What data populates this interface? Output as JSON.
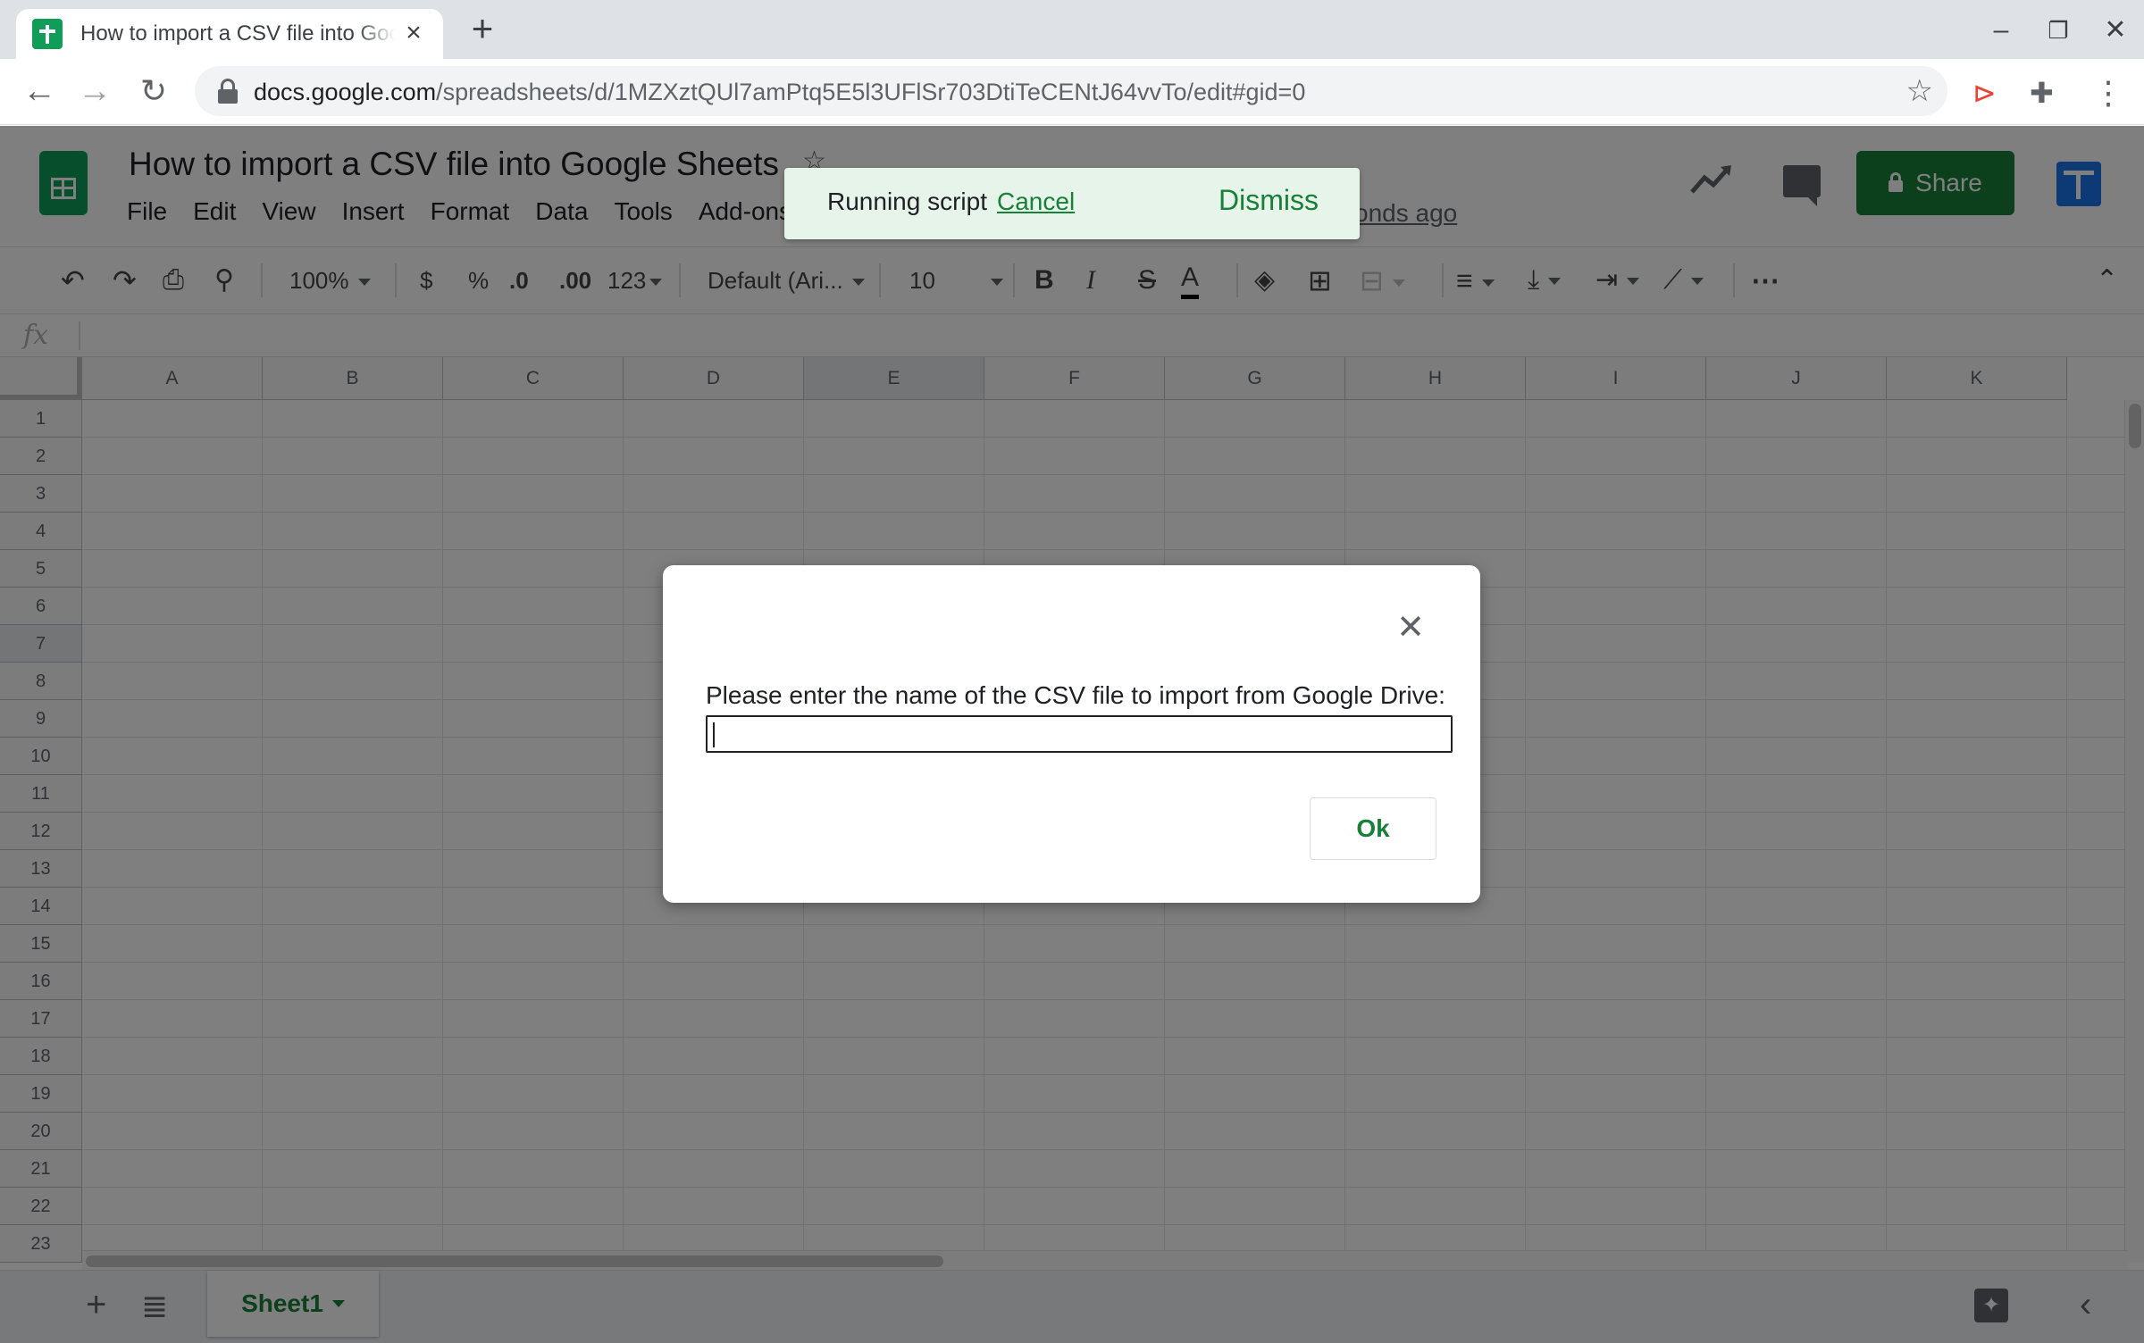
{
  "browser": {
    "tab_title": "How to import a CSV file into Google Sheets",
    "url_host": "docs.google.com",
    "url_path": "/spreadsheets/d/1MZXztQUl7amPtq5E5l3UFlSr703DtiTeCENtJ64vvTo/edit#gid=0"
  },
  "sheets": {
    "doc_title": "How to import a CSV file into Google Sheets",
    "menu": [
      "File",
      "Edit",
      "View",
      "Insert",
      "Format",
      "Data",
      "Tools",
      "Add-ons"
    ],
    "last_edit": "onds ago",
    "share_label": "Share",
    "toolbar": {
      "zoom": "100%",
      "currency": "$",
      "percent": "%",
      "dec_less": ".0",
      "dec_more": ".00",
      "more_formats": "123",
      "font": "Default (Ari...",
      "font_size": "10",
      "bold": "B",
      "italic": "I",
      "strike": "S",
      "text_color": "A",
      "more": "⋯"
    },
    "fx": "fx",
    "columns": [
      "A",
      "B",
      "C",
      "D",
      "E",
      "F",
      "G",
      "H",
      "I",
      "J",
      "K"
    ],
    "rows": [
      "1",
      "2",
      "3",
      "4",
      "5",
      "6",
      "7",
      "8",
      "9",
      "10",
      "11",
      "12",
      "13",
      "14",
      "15",
      "16",
      "17",
      "18",
      "19",
      "20",
      "21",
      "22",
      "23"
    ],
    "selected_column": "E",
    "selected_row": "7",
    "sheet_tab": "Sheet1"
  },
  "toast": {
    "message": "Running script",
    "cancel": "Cancel",
    "dismiss": "Dismiss"
  },
  "dialog": {
    "prompt": "Please enter the name of the CSV file to import from Google Drive:",
    "input_value": "",
    "ok_label": "Ok"
  },
  "colors": {
    "sheets_green": "#188038",
    "toast_bg": "#e6f4ea",
    "overlay": "rgba(0,0,0,0.5)"
  }
}
